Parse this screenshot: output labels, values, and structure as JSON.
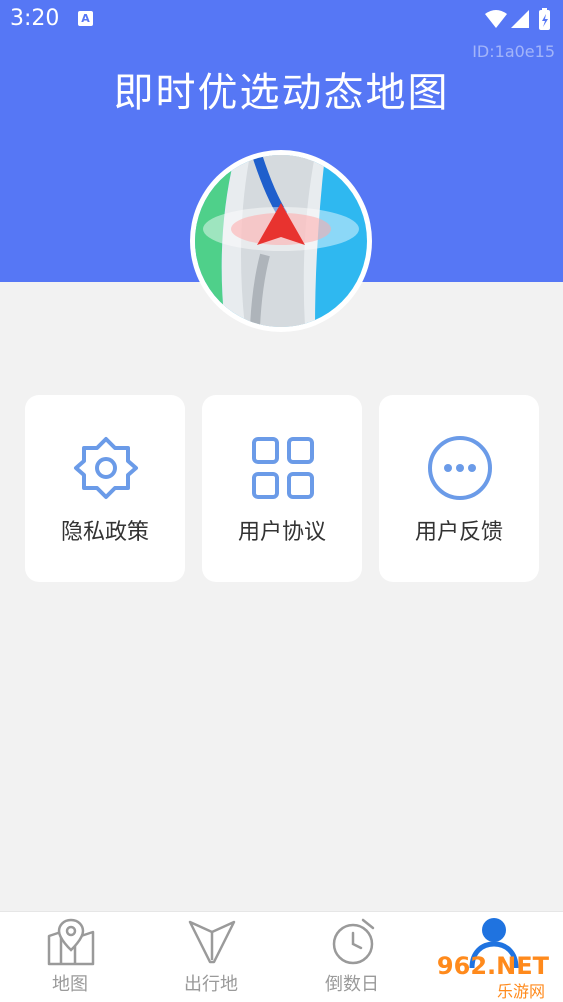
{
  "status_bar": {
    "time": "3:20",
    "notification_icon": "A"
  },
  "header": {
    "id_text": "ID:1a0e15",
    "title": "即时优选动态地图"
  },
  "cards": [
    {
      "label": "隐私政策",
      "icon": "gear-icon"
    },
    {
      "label": "用户协议",
      "icon": "grid-icon"
    },
    {
      "label": "用户反馈",
      "icon": "more-dots-icon"
    }
  ],
  "tabbar": {
    "tabs": [
      {
        "label": "地图",
        "icon": "map-pin-icon"
      },
      {
        "label": "出行地",
        "icon": "navigation-icon"
      },
      {
        "label": "倒数日",
        "icon": "alarm-clock-icon"
      },
      {
        "label": "",
        "icon": "user-icon",
        "active": true
      }
    ]
  },
  "watermark": {
    "main": "962.NET",
    "sub": "乐游网"
  },
  "colors": {
    "header_bg": "#5677f5",
    "accent": "#1f73e0",
    "icon_blue": "#6b9be8",
    "page_bg": "#f2f2f2"
  }
}
